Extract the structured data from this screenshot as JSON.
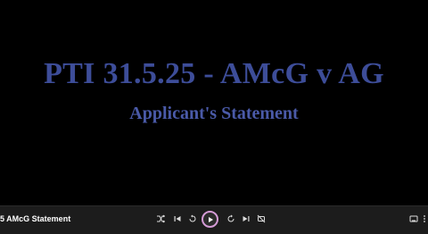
{
  "video": {
    "title": "PTI 31.5.25 - AMcG v AG",
    "subtitle": "Applicant's Statement"
  },
  "player": {
    "track_title": "5 AMcG Statement",
    "controls": [
      "shuffle-icon",
      "previous-icon",
      "rewind-10-icon",
      "play-icon",
      "forward-30-icon",
      "repeat-off-icon",
      "cast-icon",
      "more-icon"
    ],
    "accent_color": "#d49bd6"
  }
}
